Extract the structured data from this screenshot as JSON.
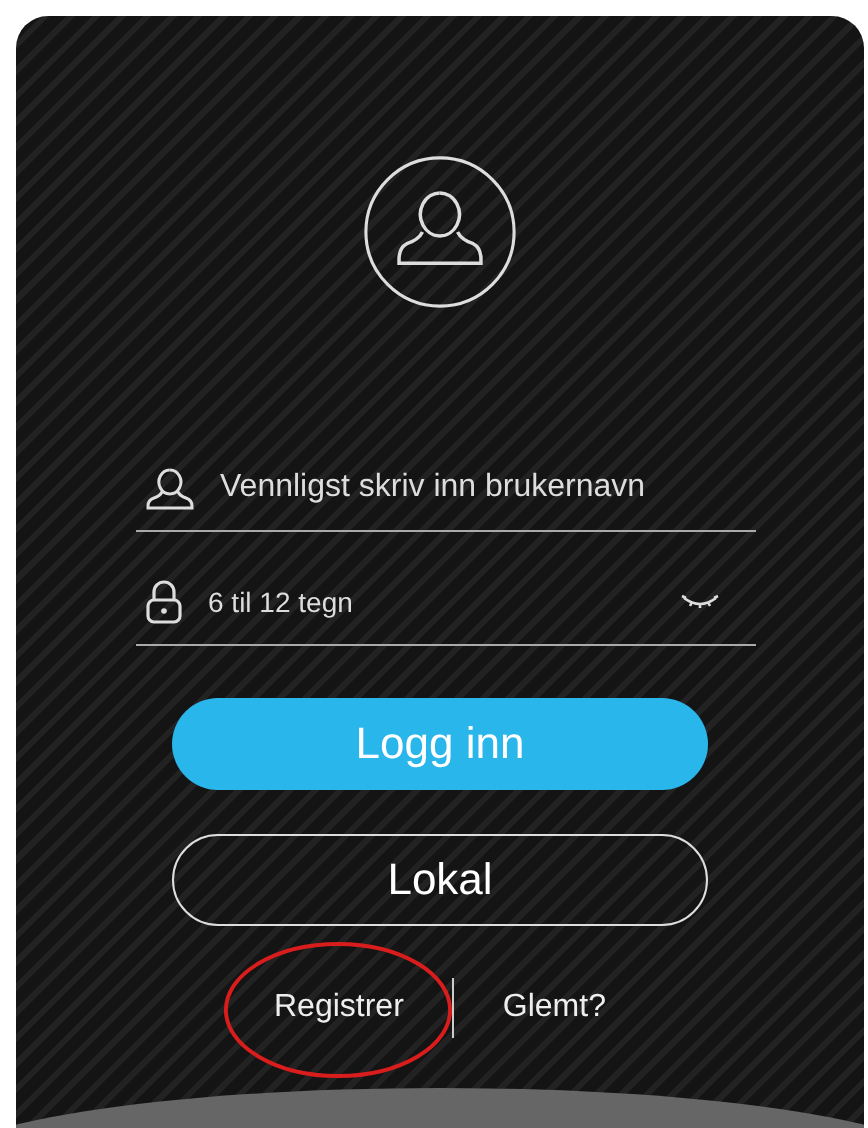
{
  "username": {
    "placeholder": "Vennligst skriv inn brukernavn"
  },
  "password": {
    "placeholder": "6 til 12 tegn"
  },
  "buttons": [
    {
      "label": "Logg inn",
      "kind": "primary"
    },
    {
      "label": "Lokal",
      "kind": "outline"
    }
  ],
  "links": [
    {
      "label": "Registrer",
      "highlighted": true
    },
    {
      "label": "Glemt?",
      "highlighted": false
    }
  ]
}
